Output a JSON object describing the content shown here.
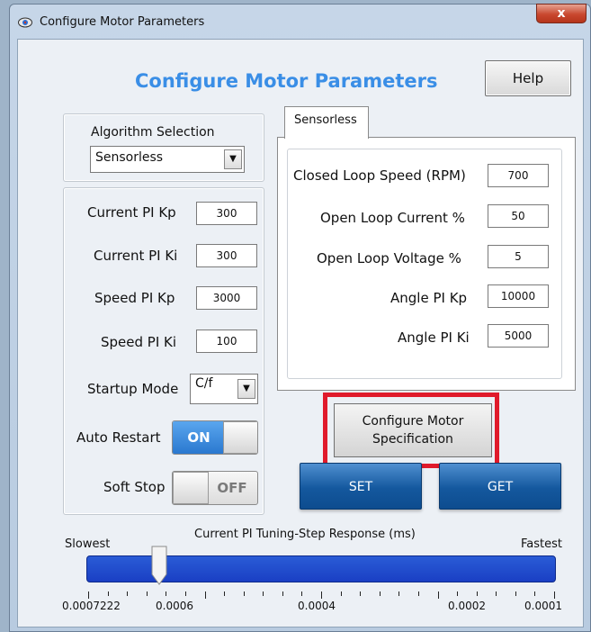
{
  "window": {
    "title": "Configure Motor Parameters",
    "close_label": "x"
  },
  "header": {
    "title": "Configure Motor Parameters",
    "help_label": "Help"
  },
  "algorithm": {
    "group_label": "Algorithm Selection",
    "selected": "Sensorless"
  },
  "left_params": [
    {
      "label": "Current PI Kp",
      "value": "300"
    },
    {
      "label": "Current PI Ki",
      "value": "300"
    },
    {
      "label": "Speed PI Kp",
      "value": "3000"
    },
    {
      "label": "Speed PI Ki",
      "value": "100"
    }
  ],
  "startup_mode": {
    "label": "Startup Mode",
    "selected": "C/f"
  },
  "auto_restart": {
    "label": "Auto Restart",
    "state": "ON"
  },
  "soft_stop": {
    "label": "Soft Stop",
    "state": "OFF"
  },
  "tab": {
    "label": "Sensorless"
  },
  "sensorless_params": [
    {
      "label": "Closed Loop Speed (RPM)",
      "value": "700"
    },
    {
      "label": "Open Loop Current %",
      "value": "50"
    },
    {
      "label": "Open Loop Voltage %",
      "value": "5"
    },
    {
      "label": "Angle PI Kp",
      "value": "10000"
    },
    {
      "label": "Angle PI Ki",
      "value": "5000"
    }
  ],
  "buttons": {
    "configure_line1": "Configure Motor",
    "configure_line2": "Specification",
    "set": "SET",
    "get": "GET"
  },
  "slider": {
    "title": "Current PI Tuning-Step Response (ms)",
    "min_label": "Slowest",
    "max_label": "Fastest",
    "ticks": [
      "0.0007222",
      "0.0006",
      "0.0004",
      "0.0002",
      "0.0001"
    ],
    "value_fraction": 0.14
  },
  "colors": {
    "heading": "#3a8ee6",
    "slider_track": "#1f4fd0",
    "highlight_outline": "#e01a2b",
    "button_blue": "#14589e"
  },
  "icons": {
    "app": "eye-icon",
    "close": "close-icon",
    "dropdown": "chevron-down-icon"
  }
}
